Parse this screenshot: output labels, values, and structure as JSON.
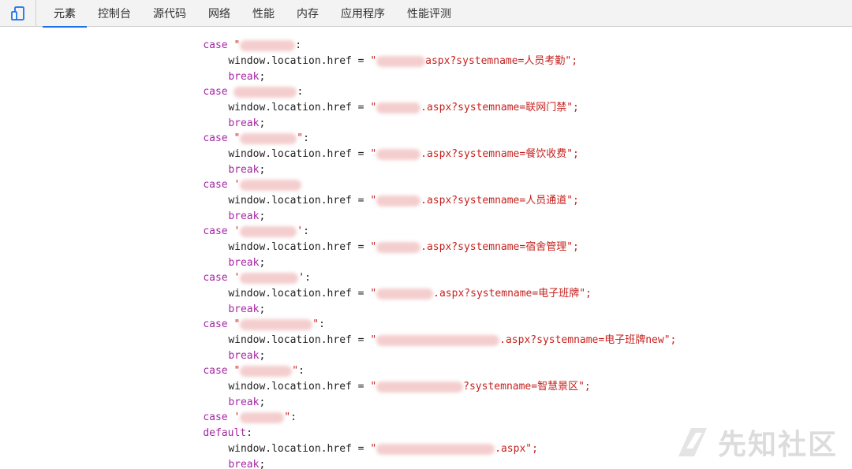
{
  "toolbar": {
    "tabs": [
      {
        "label": "元素",
        "active": true
      },
      {
        "label": "控制台"
      },
      {
        "label": "源代码"
      },
      {
        "label": "网络"
      },
      {
        "label": "性能"
      },
      {
        "label": "内存"
      },
      {
        "label": "应用程序"
      },
      {
        "label": "性能评测"
      }
    ]
  },
  "code": {
    "case_kw": "case",
    "break_kw": "break",
    "default_kw": "default",
    "assign_prefix": "window.location.href = ",
    "hrefs": [
      "aspx?systemname=人员考勤\";",
      ".aspx?systemname=联网门禁\";",
      ".aspx?systemname=餐饮收费\";",
      ".aspx?systemname=人员通道\";",
      ".aspx?systemname=宿舍管理\";",
      ".aspx?systemname=电子班牌\";",
      ".aspx?systemname=电子班牌new\";",
      "?systemname=智慧景区\";",
      ".aspx\";"
    ],
    "closing_brace": "}"
  },
  "watermark": {
    "text": "先知社区"
  },
  "colors": {
    "keyword": "#a626a4",
    "string": "#c5221f",
    "tab_underline": "#1a73e8"
  }
}
